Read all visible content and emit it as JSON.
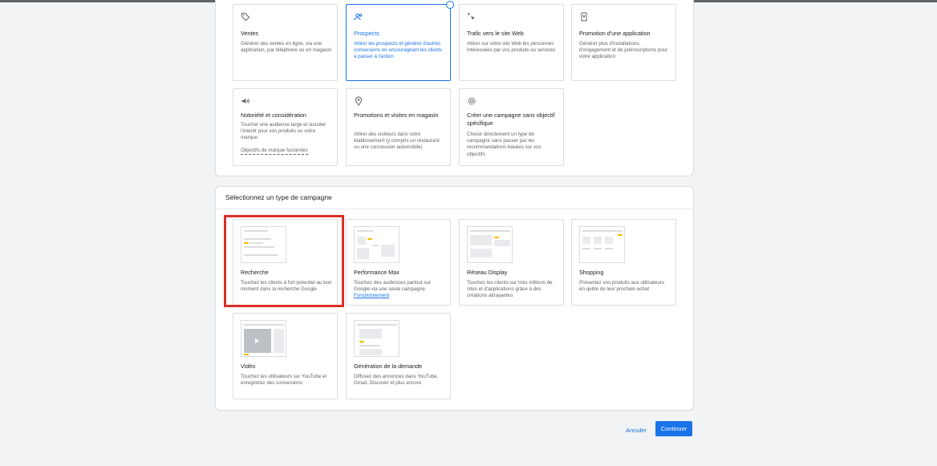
{
  "goals": [
    {
      "title": "Ventes",
      "desc": "Générer des ventes en ligne, via une application, par téléphone ou en magasin",
      "icon": "tag-icon"
    },
    {
      "title": "Prospects",
      "desc": "Attirer les prospects et générer d'autres conversions en encourageant les clients à passer à l'action",
      "icon": "people-icon",
      "selected": true
    },
    {
      "title": "Trafic vers le site Web",
      "desc": "Attirer sur votre site Web les personnes intéressées par vos produits ou services",
      "icon": "cursor-click-icon"
    },
    {
      "title": "Promotion d'une application",
      "desc": "Générer plus d'installations, d'engagement et de préinscriptions pour votre application",
      "icon": "phone-icon"
    },
    {
      "title": "Notoriété et considération",
      "desc": "Toucher une audience large et susciter l'intérêt pour vos produits ou votre marque",
      "link": "Objectifs de marque fusionnés",
      "icon": "megaphone-icon"
    },
    {
      "title": "Promotions et visites en magasin",
      "desc": "Attirer des visiteurs dans votre établissement (y compris un restaurant ou une concession automobile)",
      "icon": "location-pin-icon"
    },
    {
      "title": "Créer une campagne sans objectif spécifique",
      "desc": "Choisir directement un type de campagne sans passer par les recommandations basées sur vos objectifs",
      "icon": "gear-icon"
    }
  ],
  "campaign_section_title": "Sélectionnez un type de campagne",
  "campaign_types": [
    {
      "title": "Recherche",
      "desc": "Touchez les clients à fort potentiel au bon moment dans la recherche Google"
    },
    {
      "title": "Performance Max",
      "desc": "Touchez des audiences partout sur Google via une seule campagne.",
      "link": "Fonctionnement"
    },
    {
      "title": "Réseau Display",
      "desc": "Touchez les clients sur trois millions de sites et d'applications grâce à des créations attrayantes"
    },
    {
      "title": "Shopping",
      "desc": "Présentez vos produits aux utilisateurs en quête de leur prochain achat"
    },
    {
      "title": "Vidéo",
      "desc": "Touchez les utilisateurs sur YouTube et enregistrez des conversions"
    },
    {
      "title": "Génération de la demande",
      "desc": "Diffusez des annonces dans YouTube, Gmail, Discover et plus encore"
    }
  ],
  "buttons": {
    "cancel": "Annuler",
    "continue": "Continuer"
  },
  "colors": {
    "accent": "#1a73e8",
    "highlight": "#d93025",
    "thumb_accent": "#fbbc04"
  }
}
